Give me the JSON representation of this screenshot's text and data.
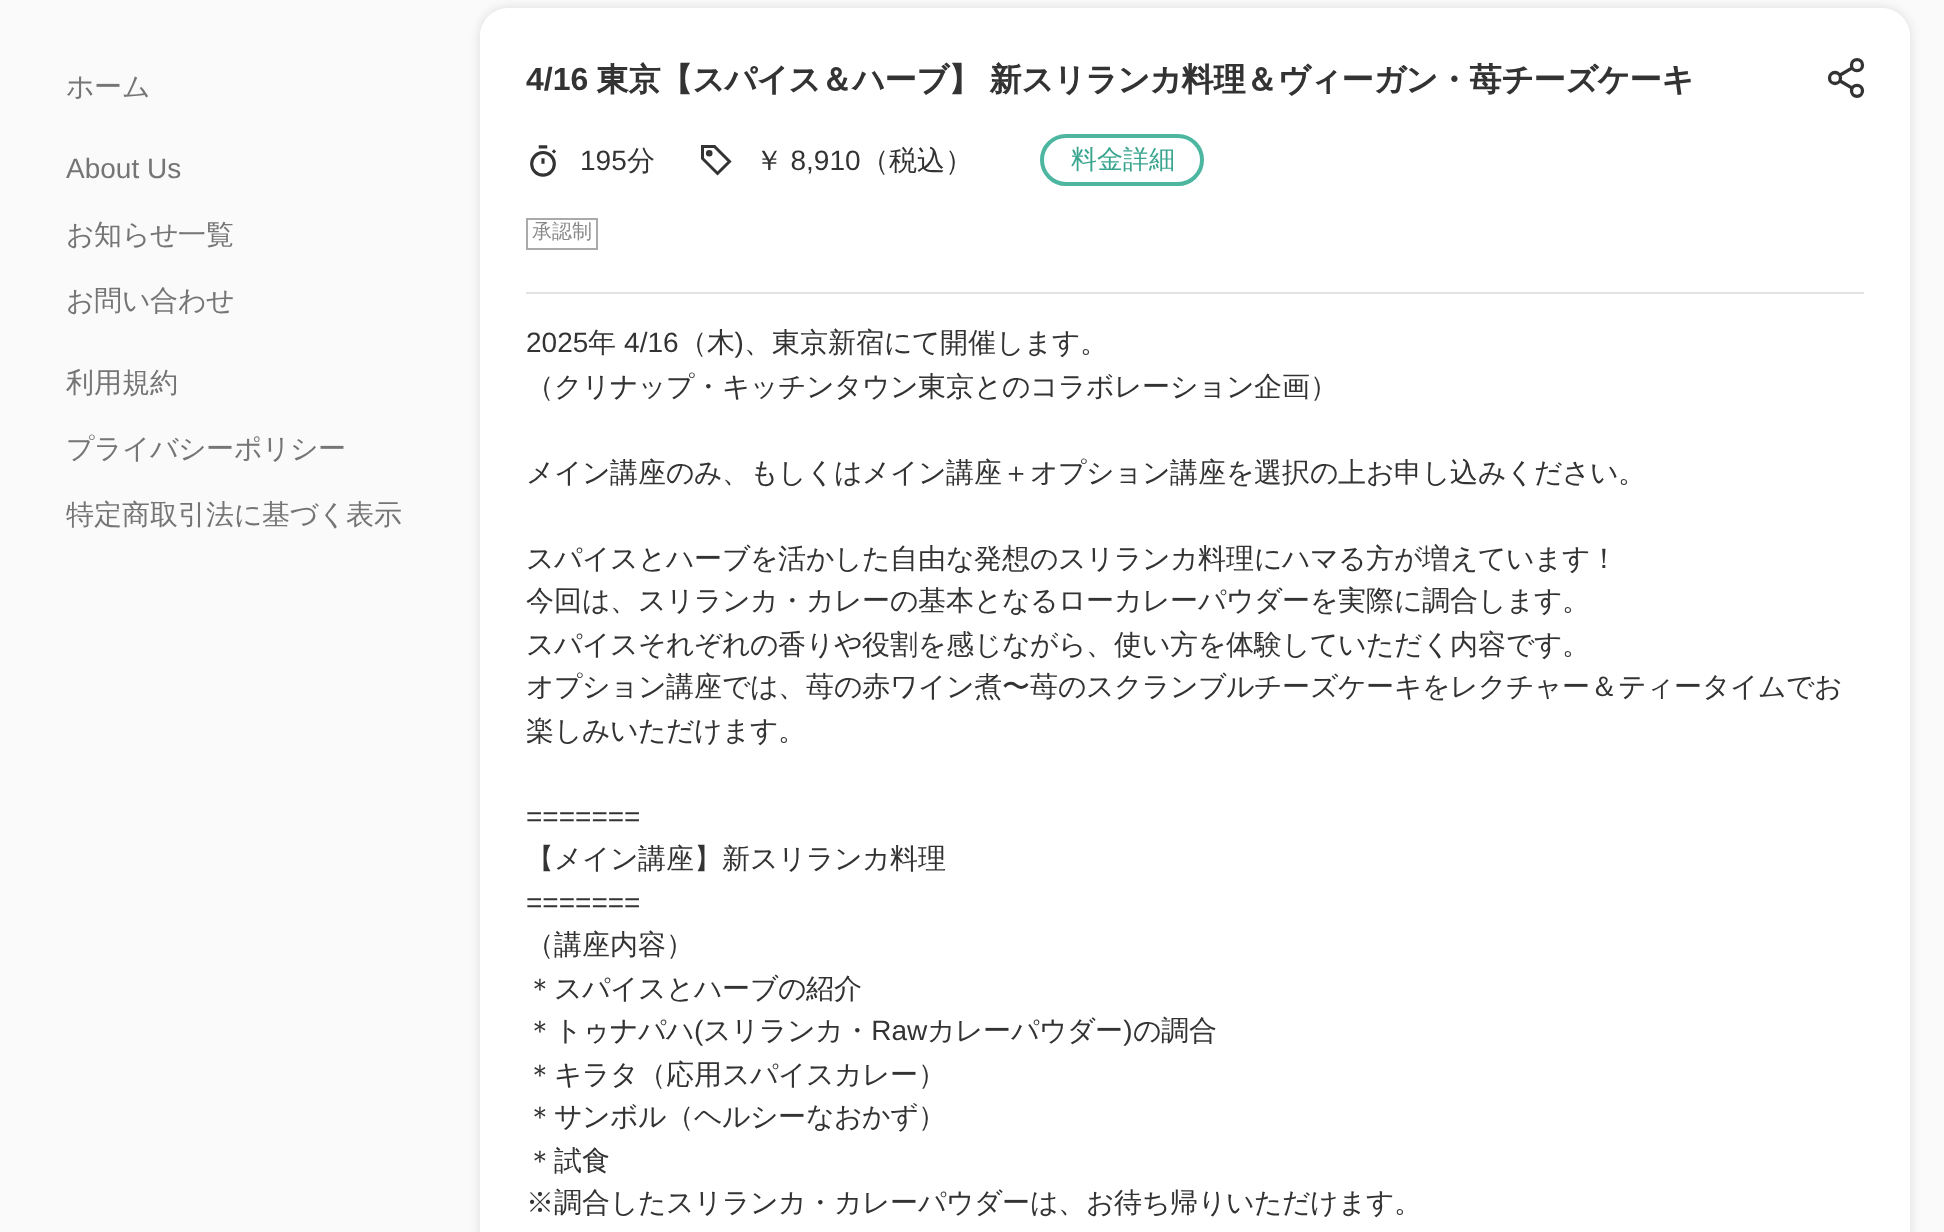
{
  "sidebar": {
    "groups": [
      {
        "items": [
          "ホーム"
        ]
      },
      {
        "items": [
          "About Us",
          "お知らせ一覧",
          "お問い合わせ"
        ]
      },
      {
        "items": [
          "利用規約",
          "プライバシーポリシー",
          "特定商取引法に基づく表示"
        ]
      }
    ]
  },
  "event": {
    "title": "4/16 東京【スパイス＆ハーブ】 新スリランカ料理＆ヴィーガン・苺チーズケーキ",
    "duration": "195分",
    "price": "￥ 8,910（税込）",
    "price_button": "料金詳細",
    "tag": "承認制",
    "description": [
      [
        "2025年 4/16（木)、東京新宿にて開催します。",
        "（クリナップ・キッチンタウン東京とのコラボレーション企画）"
      ],
      [
        "メイン講座のみ、もしくはメイン講座＋オプション講座を選択の上お申し込みください。"
      ],
      [
        "スパイスとハーブを活かした自由な発想のスリランカ料理にハマる方が増えています！",
        "今回は、スリランカ・カレーの基本となるローカレーパウダーを実際に調合します。",
        "スパイスそれぞれの香りや役割を感じながら、使い方を体験していただく内容です。",
        "オプション講座では、苺の赤ワイン煮〜苺のスクランブルチーズケーキをレクチャー＆ティータイムでお楽しみいただけます。"
      ],
      [
        "=======",
        "【メイン講座】新スリランカ料理",
        "=======",
        "（講座内容）",
        "＊スパイスとハーブの紹介",
        "＊トゥナパハ(スリランカ・Rawカレーパウダー)の調合",
        "＊キラタ（応用スパイスカレー）",
        "＊サンボル（ヘルシーなおかず）",
        "＊試食",
        "※調合したスリランカ・カレーパウダーは、お待ち帰りいただけます。"
      ]
    ]
  }
}
